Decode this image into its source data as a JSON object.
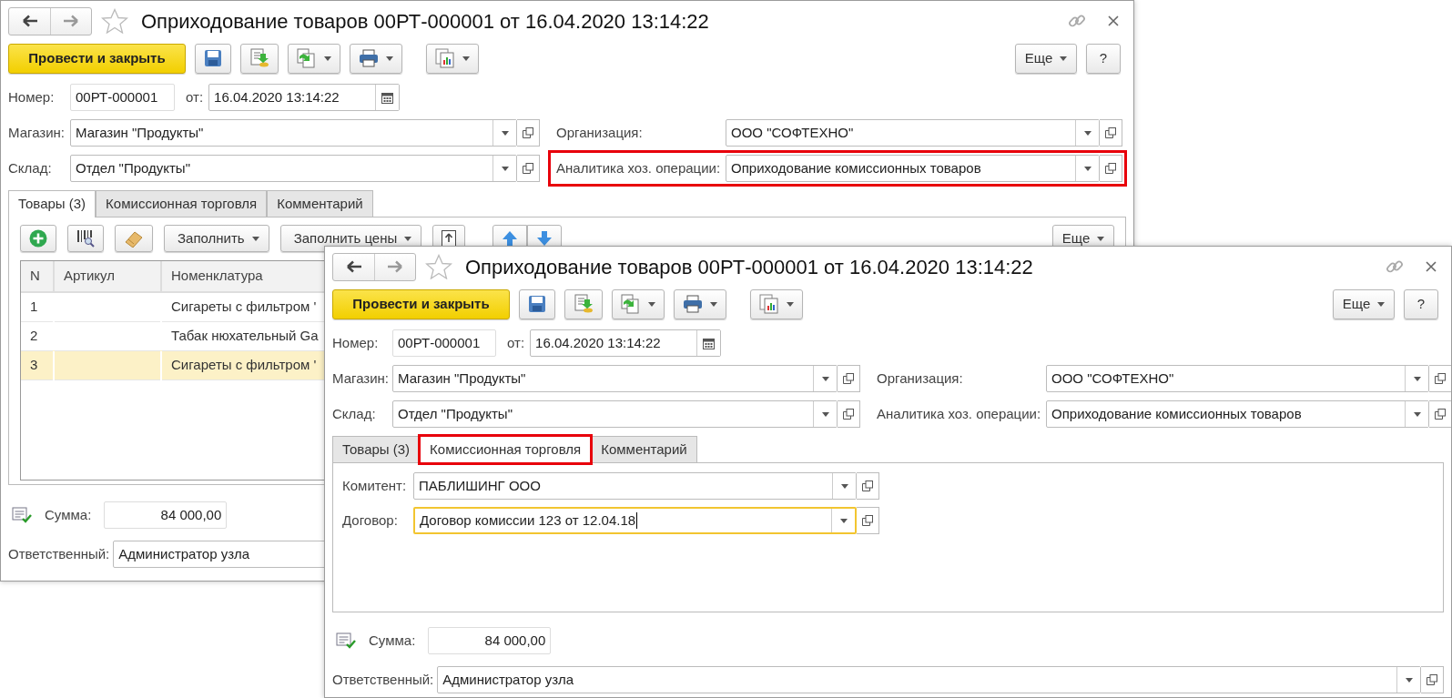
{
  "windows": [
    {
      "title": "Оприходование товаров 00РТ-000001 от 16.04.2020 13:14:22",
      "post_button": "Провести и закрыть",
      "more_button": "Еще",
      "help_button": "?",
      "number": {
        "label": "Номер:",
        "value": "00РТ-000001"
      },
      "date": {
        "label": "от:",
        "value": "16.04.2020 13:14:22"
      },
      "fields": [
        {
          "label": "Магазин:",
          "value": "Магазин \"Продукты\"",
          "highlighted": false
        },
        {
          "label": "Организация:",
          "value": "ООО \"СОФТЕХНО\"",
          "highlighted": false
        },
        {
          "label": "Склад:",
          "value": "Отдел \"Продукты\"",
          "highlighted": false
        },
        {
          "label": "Аналитика хоз. операции:",
          "value": "Оприходование комиссионных товаров",
          "highlighted": true
        }
      ],
      "tabs": [
        {
          "label": "Товары (3)",
          "selected": true,
          "highlighted": false
        },
        {
          "label": "Комиссионная торговля",
          "selected": false,
          "highlighted": false
        },
        {
          "label": "Комментарий",
          "selected": false,
          "highlighted": false
        }
      ],
      "tab_content": {
        "kind": "table",
        "toolbar": [
          {
            "kind": "add"
          },
          {
            "kind": "barcode"
          },
          {
            "kind": "eraser"
          },
          {
            "kind": "menu",
            "label": "Заполнить"
          },
          {
            "kind": "menu",
            "label": "Заполнить цены"
          },
          {
            "kind": "upload"
          },
          {
            "kind": "updown"
          },
          {
            "kind": "more",
            "label": "Еще"
          }
        ],
        "columns": [
          "N",
          "Артикул",
          "Номенклатура"
        ],
        "rows": [
          {
            "n": "1",
            "item": "Сигареты с фильтром '",
            "selected": false
          },
          {
            "n": "2",
            "item": "Табак нюхательный Ga",
            "selected": false
          },
          {
            "n": "3",
            "item": "Сигареты с фильтром '",
            "selected": true
          }
        ]
      },
      "sum": {
        "label": "Сумма:",
        "value": "84 000,00"
      },
      "responsible": {
        "label": "Ответственный:",
        "value": "Администратор узла"
      }
    },
    {
      "title": "Оприходование товаров 00РТ-000001 от 16.04.2020 13:14:22",
      "post_button": "Провести и закрыть",
      "more_button": "Еще",
      "help_button": "?",
      "number": {
        "label": "Номер:",
        "value": "00РТ-000001"
      },
      "date": {
        "label": "от:",
        "value": "16.04.2020 13:14:22"
      },
      "fields": [
        {
          "label": "Магазин:",
          "value": "Магазин \"Продукты\"",
          "highlighted": false
        },
        {
          "label": "Организация:",
          "value": "ООО \"СОФТЕХНО\"",
          "highlighted": false
        },
        {
          "label": "Склад:",
          "value": "Отдел \"Продукты\"",
          "highlighted": false
        },
        {
          "label": "Аналитика хоз. операции:",
          "value": "Оприходование комиссионных товаров",
          "highlighted": false
        }
      ],
      "tabs": [
        {
          "label": "Товары (3)",
          "selected": false,
          "highlighted": false
        },
        {
          "label": "Комиссионная торговля",
          "selected": true,
          "highlighted": true
        },
        {
          "label": "Комментарий",
          "selected": false,
          "highlighted": false
        }
      ],
      "tab_content": {
        "kind": "form",
        "fields": [
          {
            "label": "Комитент:",
            "value": "ПАБЛИШИНГ ООО",
            "focused": false
          },
          {
            "label": "Договор:",
            "value": "Договор комиссии 123 от 12.04.18",
            "focused": true
          }
        ]
      },
      "sum": {
        "label": "Сумма:",
        "value": "84 000,00"
      },
      "responsible": {
        "label": "Ответственный:",
        "value": "Администратор узла",
        "dropdown": true
      }
    }
  ]
}
